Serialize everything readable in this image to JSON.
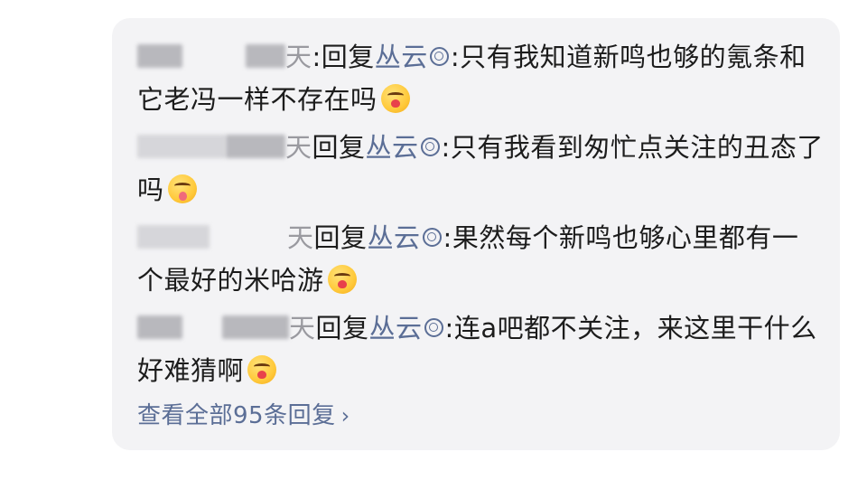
{
  "replies": [
    {
      "name_part": "天",
      "reply_word": ":回复",
      "target": "丛云",
      "text": ":只有我知道新鸣也够的氪条和它老冯一样不存在吗",
      "emoji": "laughing-face-icon"
    },
    {
      "name_part": "天",
      "reply_word": "回复",
      "target": "丛云",
      "text": ":只有我看到匆忙点关注的丑态了吗",
      "emoji": "tongue-face-icon"
    },
    {
      "name_part": "天",
      "reply_word": "回复",
      "target": "丛云",
      "text": ":果然每个新鸣也够心里都有一个最好的米哈游",
      "emoji": "laughing-face-icon"
    },
    {
      "name_part": "天",
      "reply_word": "回复",
      "target": "丛云",
      "text": ":连a吧都不关注，来这里干什么好难猜啊",
      "emoji": "laughing-face-icon"
    }
  ],
  "view_all": {
    "label": "查看全部95条回复",
    "chevron": "›"
  },
  "colors": {
    "link": "#5b6e96",
    "text": "#1c1c1c",
    "panel": "#f3f3f5"
  }
}
